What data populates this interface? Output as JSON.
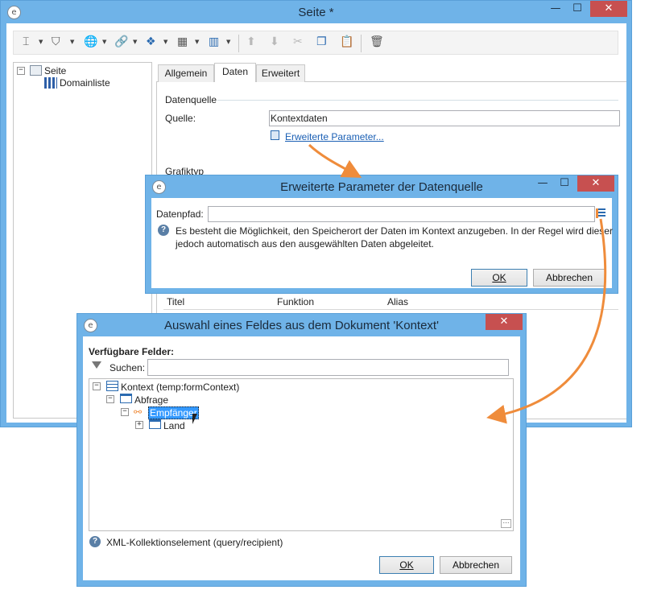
{
  "main_window": {
    "title": "Seite *",
    "tree": {
      "root_label": "Seite",
      "child_label": "Domainliste"
    },
    "tabs": [
      {
        "label": "Allgemein"
      },
      {
        "label": "Daten"
      },
      {
        "label": "Erweitert"
      }
    ],
    "datasource_group": "Datenquelle",
    "source_label": "Quelle:",
    "source_value": "Kontextdaten",
    "advanced_link": "Erweiterte Parameter...",
    "charttype_group": "Grafiktyp",
    "columns": [
      "Titel",
      "Funktion",
      "Alias"
    ]
  },
  "dialog_params": {
    "title": "Erweiterte Parameter der Datenquelle",
    "path_label": "Datenpfad:",
    "path_value": "",
    "help_line1": "Es besteht die Möglichkeit, den Speicherort der Daten im Kontext anzugeben. In der Regel wird dieser",
    "help_line2": "jedoch automatisch aus den ausgewählten Daten abgeleitet.",
    "ok": "OK",
    "cancel": "Abbrechen"
  },
  "dialog_field": {
    "title": "Auswahl eines Feldes aus dem Dokument 'Kontext'",
    "available_label": "Verfügbare Felder:",
    "search_label": "Suchen:",
    "search_value": "",
    "tree": [
      {
        "label": "Kontext (temp:formContext)"
      },
      {
        "label": "Abfrage"
      },
      {
        "label": "Empfänger"
      },
      {
        "label": "Land"
      }
    ],
    "footer_help": "XML-Kollektionselement (query/recipient)",
    "ok": "OK",
    "cancel": "Abbrechen"
  },
  "colors": {
    "title_bar": "#6fb3e8",
    "close_button": "#c75050",
    "link": "#1a5fb4",
    "arrow": "#ef8c3b",
    "selection": "#3399ff"
  }
}
